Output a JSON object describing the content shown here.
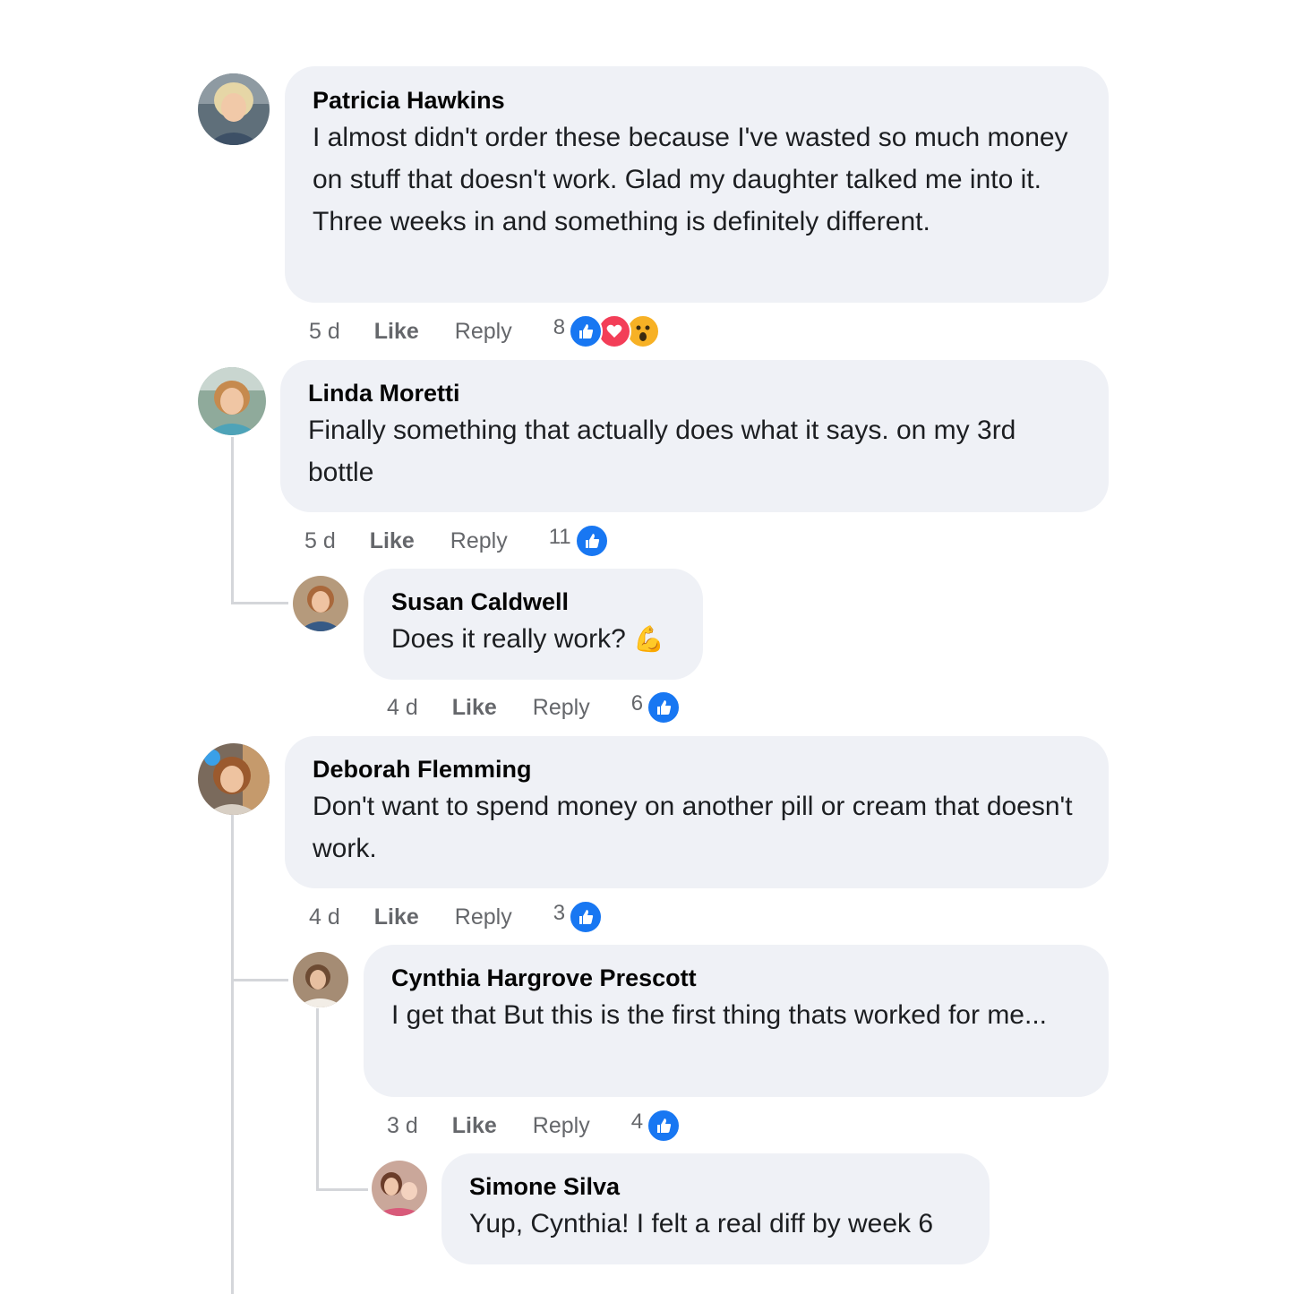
{
  "comments": [
    {
      "name": "Patricia Hawkins",
      "text": "I almost didn't order these because I've wasted so much money on stuff that doesn't work. Glad my daughter talked me into it. Three weeks in and something is definitely different.",
      "time": "5 d",
      "like_label": "Like",
      "reply_label": "Reply",
      "reaction_count": "8",
      "reactions": [
        "like-icon",
        "love-icon",
        "wow-icon"
      ]
    },
    {
      "name": "Linda Moretti",
      "text": "Finally something that actually does what it says. on my 3rd bottle",
      "time": "5 d",
      "like_label": "Like",
      "reply_label": "Reply",
      "reaction_count": "11",
      "reactions": [
        "like-icon"
      ]
    },
    {
      "name": "Susan Caldwell",
      "text": "Does it really work?",
      "emoji": "💪",
      "time": "4 d",
      "like_label": "Like",
      "reply_label": "Reply",
      "reaction_count": "6",
      "reactions": [
        "like-icon"
      ]
    },
    {
      "name": "Deborah Flemming",
      "text": "Don't want to spend money on another pill or cream that doesn't work.",
      "time": "4 d",
      "like_label": "Like",
      "reply_label": "Reply",
      "reaction_count": "3",
      "reactions": [
        "like-icon"
      ]
    },
    {
      "name": "Cynthia Hargrove Prescott",
      "text": "I get that But this is the first thing thats worked for me...",
      "time": "3 d",
      "like_label": "Like",
      "reply_label": "Reply",
      "reaction_count": "4",
      "reactions": [
        "like-icon"
      ]
    },
    {
      "name": "Simone Silva",
      "text": "Yup, Cynthia! I felt a real diff by week 6"
    }
  ],
  "colors": {
    "bubble": "#eff1f6",
    "meta_text": "#65676b",
    "like_blue": "#1877f2",
    "love_red": "#f33e58",
    "wow_yellow": "#f7b125",
    "thread_line": "#d4d6da"
  }
}
